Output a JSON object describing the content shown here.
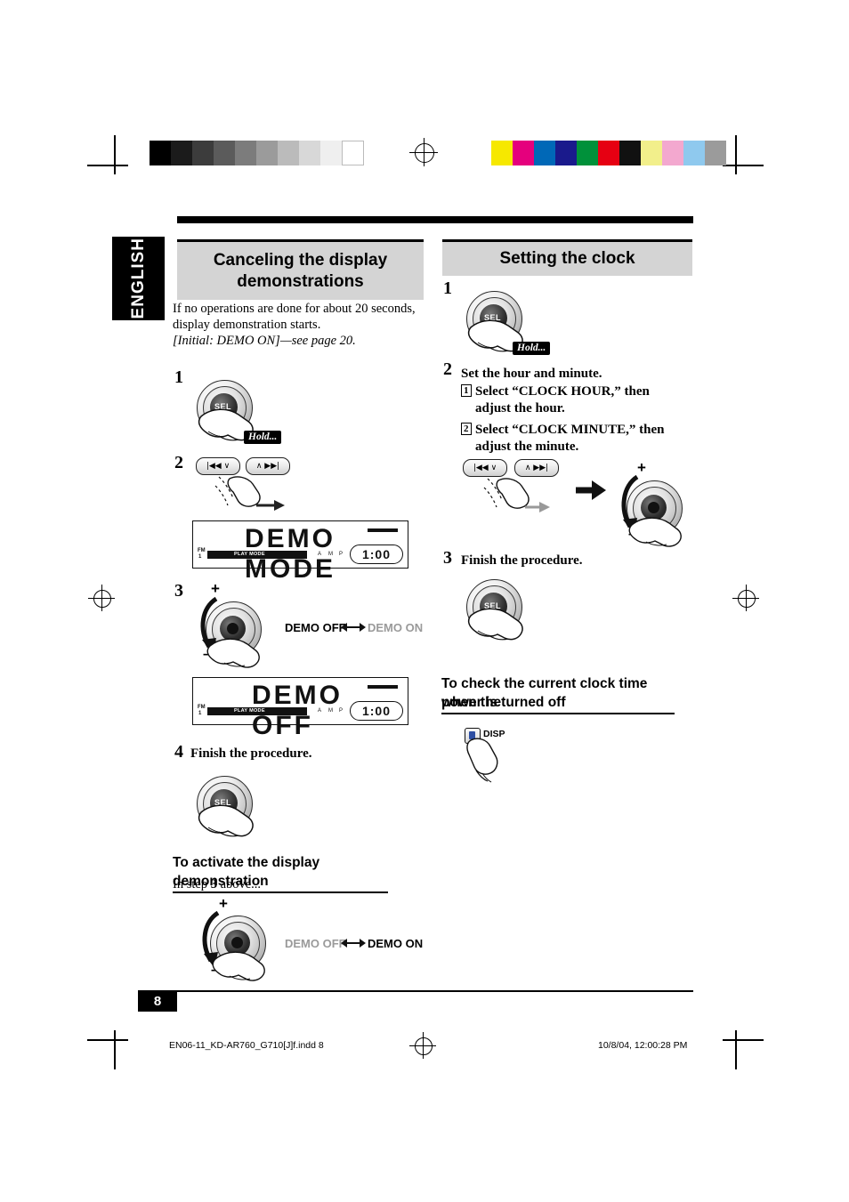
{
  "page": {
    "language_tab": "ENGLISH",
    "page_number": "8",
    "footer_left": "EN06-11_KD-AR760_G710[J]f.indd   8",
    "footer_right": "10/8/04, 12:00:28 PM"
  },
  "left_column": {
    "heading_line1": "Canceling the display",
    "heading_line2": "demonstrations",
    "intro_line1": "If no operations are done for about 20 seconds,",
    "intro_line2": "display demonstration starts.",
    "intro_italic": "[Initial: DEMO ON]—see page 20.",
    "step1": {
      "number": "1",
      "hold_tag": "Hold...",
      "knob_label": "SEL"
    },
    "step2": {
      "number": "2",
      "button_left": "|◀◀  ∨",
      "button_right": "∧  ▶▶|"
    },
    "lcd1": {
      "main_text": "DEMO MODE",
      "band": "FM",
      "preset": "1",
      "chip": "PLAY MODE",
      "clock": "1:00",
      "marks": [
        "A",
        "M",
        "P"
      ]
    },
    "step3": {
      "number": "3",
      "plus": "+",
      "minus": "–",
      "option_off": "DEMO OFF",
      "option_on": "DEMO ON",
      "selected": "DEMO OFF"
    },
    "lcd2": {
      "main_text": "DEMO OFF",
      "band": "FM",
      "preset": "1",
      "chip": "PLAY MODE",
      "clock": "1:00",
      "marks": [
        "A",
        "M",
        "P"
      ]
    },
    "step4": {
      "number": "4",
      "label": "Finish the procedure.",
      "knob_label": "SEL"
    },
    "subsection": {
      "title": "To activate the display demonstration",
      "text_pre": "In step ",
      "text_bold": "3",
      "text_post": " above...",
      "plus": "+",
      "minus": "–",
      "option_off": "DEMO OFF",
      "option_on": "DEMO ON",
      "selected": "DEMO ON"
    }
  },
  "right_column": {
    "heading": "Setting the clock",
    "step1": {
      "number": "1",
      "hold_tag": "Hold...",
      "knob_label": "SEL"
    },
    "step2": {
      "number": "2",
      "label": "Set the hour and minute.",
      "sub1_marker": "1",
      "sub1_line1": "Select “CLOCK HOUR,” then",
      "sub1_line2": "adjust the hour.",
      "sub2_marker": "2",
      "sub2_line1": "Select “CLOCK MINUTE,” then",
      "sub2_line2": "adjust the minute.",
      "button_left": "|◀◀  ∨",
      "button_right": "∧  ▶▶|",
      "plus": "+",
      "minus": "–"
    },
    "step3": {
      "number": "3",
      "label": "Finish the procedure.",
      "knob_label": "SEL"
    },
    "subsection": {
      "title_line1": "To check the current clock time when the",
      "title_line2": "power is turned off",
      "button_label": "DISP"
    }
  }
}
